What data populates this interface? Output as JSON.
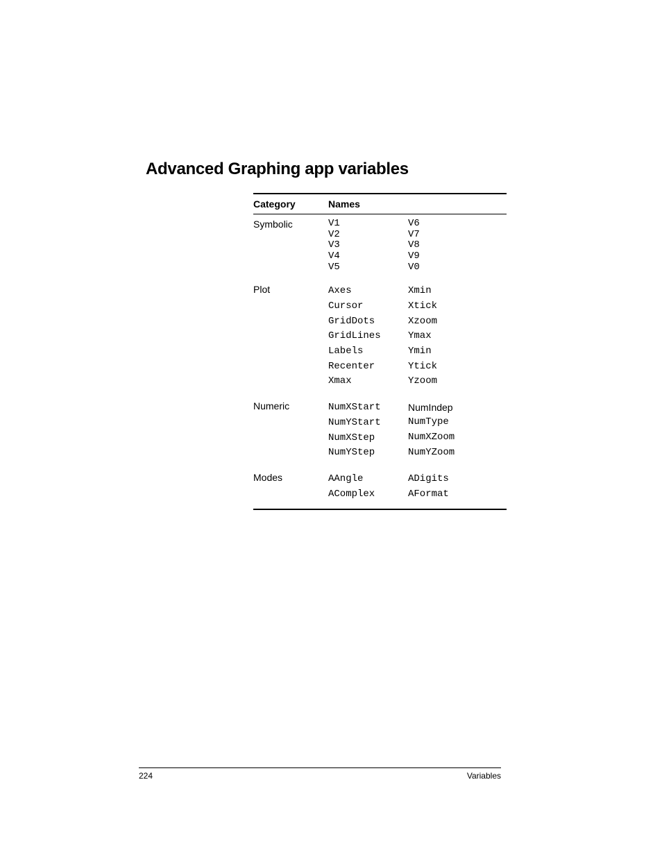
{
  "heading": "Advanced Graphing app variables",
  "table": {
    "headers": {
      "category": "Category",
      "names": "Names"
    },
    "rows": [
      {
        "category": "Symbolic",
        "tight": true,
        "col1": [
          "V1",
          "V2",
          "V3",
          "V4",
          "V5"
        ],
        "col2": [
          "V6",
          "V7",
          "V8",
          "V9",
          "V0"
        ]
      },
      {
        "category": "Plot",
        "tight": false,
        "col1": [
          "Axes",
          "Cursor",
          "GridDots",
          "GridLines",
          "Labels",
          "Recenter",
          "Xmax"
        ],
        "col2": [
          "Xmin",
          "Xtick",
          "Xzoom",
          "Ymax",
          "Ymin",
          "Ytick",
          "Yzoom"
        ]
      },
      {
        "category": "Numeric",
        "tight": false,
        "col1": [
          "NumXStart",
          "NumYStart",
          "NumXStep",
          "NumYStep"
        ],
        "col2": [
          {
            "text": "NumIndep",
            "sans": true
          },
          {
            "text": "NumType",
            "sans": false
          },
          {
            "text": "NumXZoom",
            "sans": false
          },
          {
            "text": "NumYZoom",
            "sans": false
          }
        ]
      },
      {
        "category": "Modes",
        "tight": false,
        "col1": [
          "AAngle",
          "AComplex"
        ],
        "col2": [
          "ADigits",
          "AFormat"
        ]
      }
    ]
  },
  "footer": {
    "page": "224",
    "section": "Variables"
  }
}
